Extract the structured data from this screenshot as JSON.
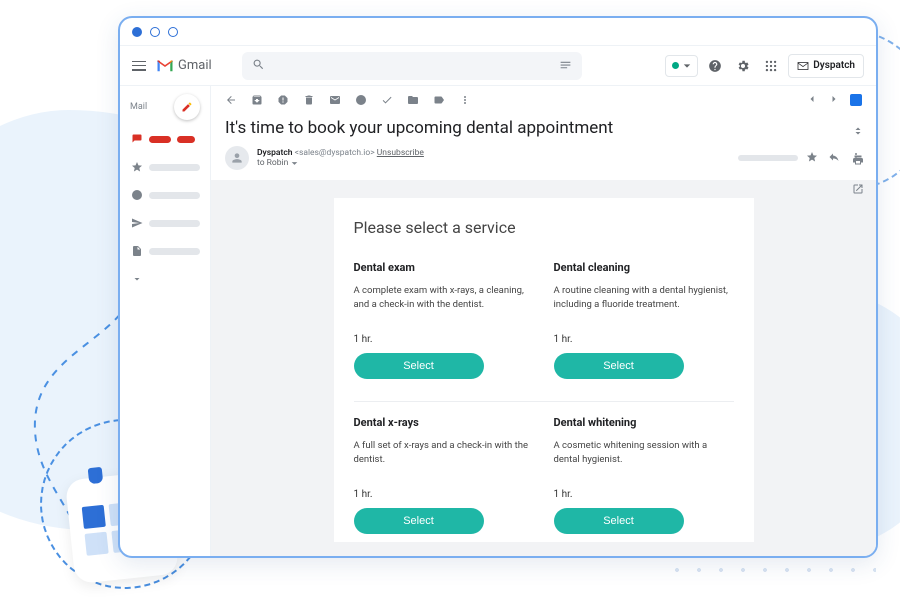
{
  "brand": {
    "name": "Gmail"
  },
  "header": {
    "addon_button": "Dyspatch"
  },
  "sidebar": {
    "label": "Mail"
  },
  "message": {
    "subject": "It's time to book your upcoming dental appointment",
    "sender_name": "Dyspatch",
    "sender_addr": "<sales@dyspatch.io>",
    "unsubscribe": "Unsubscribe",
    "recipient_line": "to Robin"
  },
  "email": {
    "heading": "Please select a service",
    "select_label": "Select",
    "services": [
      {
        "title": "Dental exam",
        "desc": "A complete exam with x-rays, a cleaning, and a check-in with the dentist.",
        "duration": "1 hr."
      },
      {
        "title": "Dental cleaning",
        "desc": "A routine cleaning with a dental hygienist, including a fluoride treatment.",
        "duration": "1 hr."
      },
      {
        "title": "Dental x-rays",
        "desc": "A full set of x-rays and a check-in with the dentist.",
        "duration": "1 hr."
      },
      {
        "title": "Dental whitening",
        "desc": "A cosmetic whitening session with a dental hygienist.",
        "duration": "1 hr."
      }
    ]
  },
  "colors": {
    "accent": "#1fb7a6",
    "chrome_blue": "#2d6fd6"
  }
}
